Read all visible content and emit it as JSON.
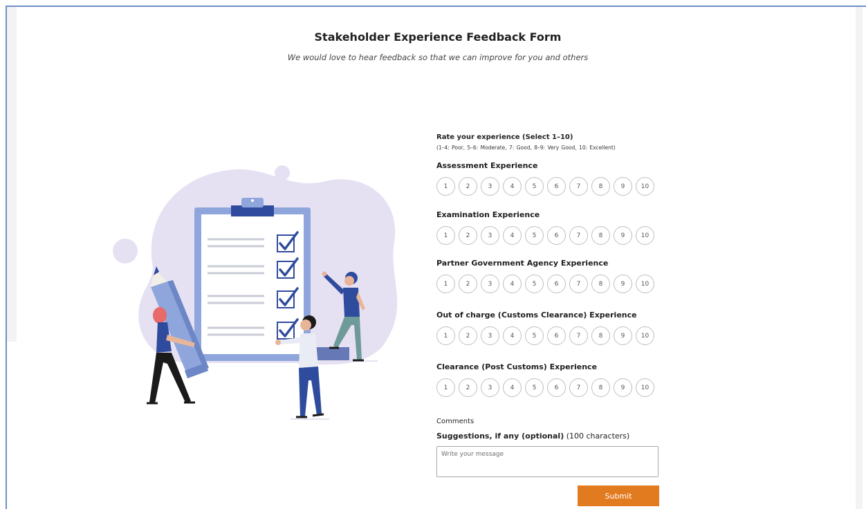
{
  "header": {
    "title": "Stakeholder Experience Feedback Form",
    "subtitle": "We would love to hear feedback so that we can improve for you and others"
  },
  "rating_info": {
    "title": "Rate your experience (Select 1–10)",
    "legend": "(1–4: Poor,  5–6: Moderate,  7: Good,  8–9: Very Good,  10: Excellent)"
  },
  "scale": [
    "1",
    "2",
    "3",
    "4",
    "5",
    "6",
    "7",
    "8",
    "9",
    "10"
  ],
  "sections": [
    {
      "label": "Assessment Experience"
    },
    {
      "label": "Examination Experience"
    },
    {
      "label": "Partner Government Agency Experience"
    },
    {
      "label": "Out of charge (Customs Clearance) Experience"
    },
    {
      "label": "Clearance (Post Customs) Experience"
    }
  ],
  "comments": {
    "label": "Comments",
    "suggestions_bold": "Suggestions, if any (optional)",
    "suggestions_note": "(100 characters)",
    "placeholder": "Write your message"
  },
  "submit_label": "Submit",
  "colors": {
    "accent": "#e27b1f",
    "frame_border": "#6f8fc6",
    "clipboard": "#8ea6dc",
    "clipboard_dark": "#2f4b9d",
    "blob": "#e6e1f2"
  },
  "illustration": {
    "icons": [
      "clipboard-icon",
      "checkmark-icon",
      "pencil-icon",
      "person-icon"
    ]
  }
}
